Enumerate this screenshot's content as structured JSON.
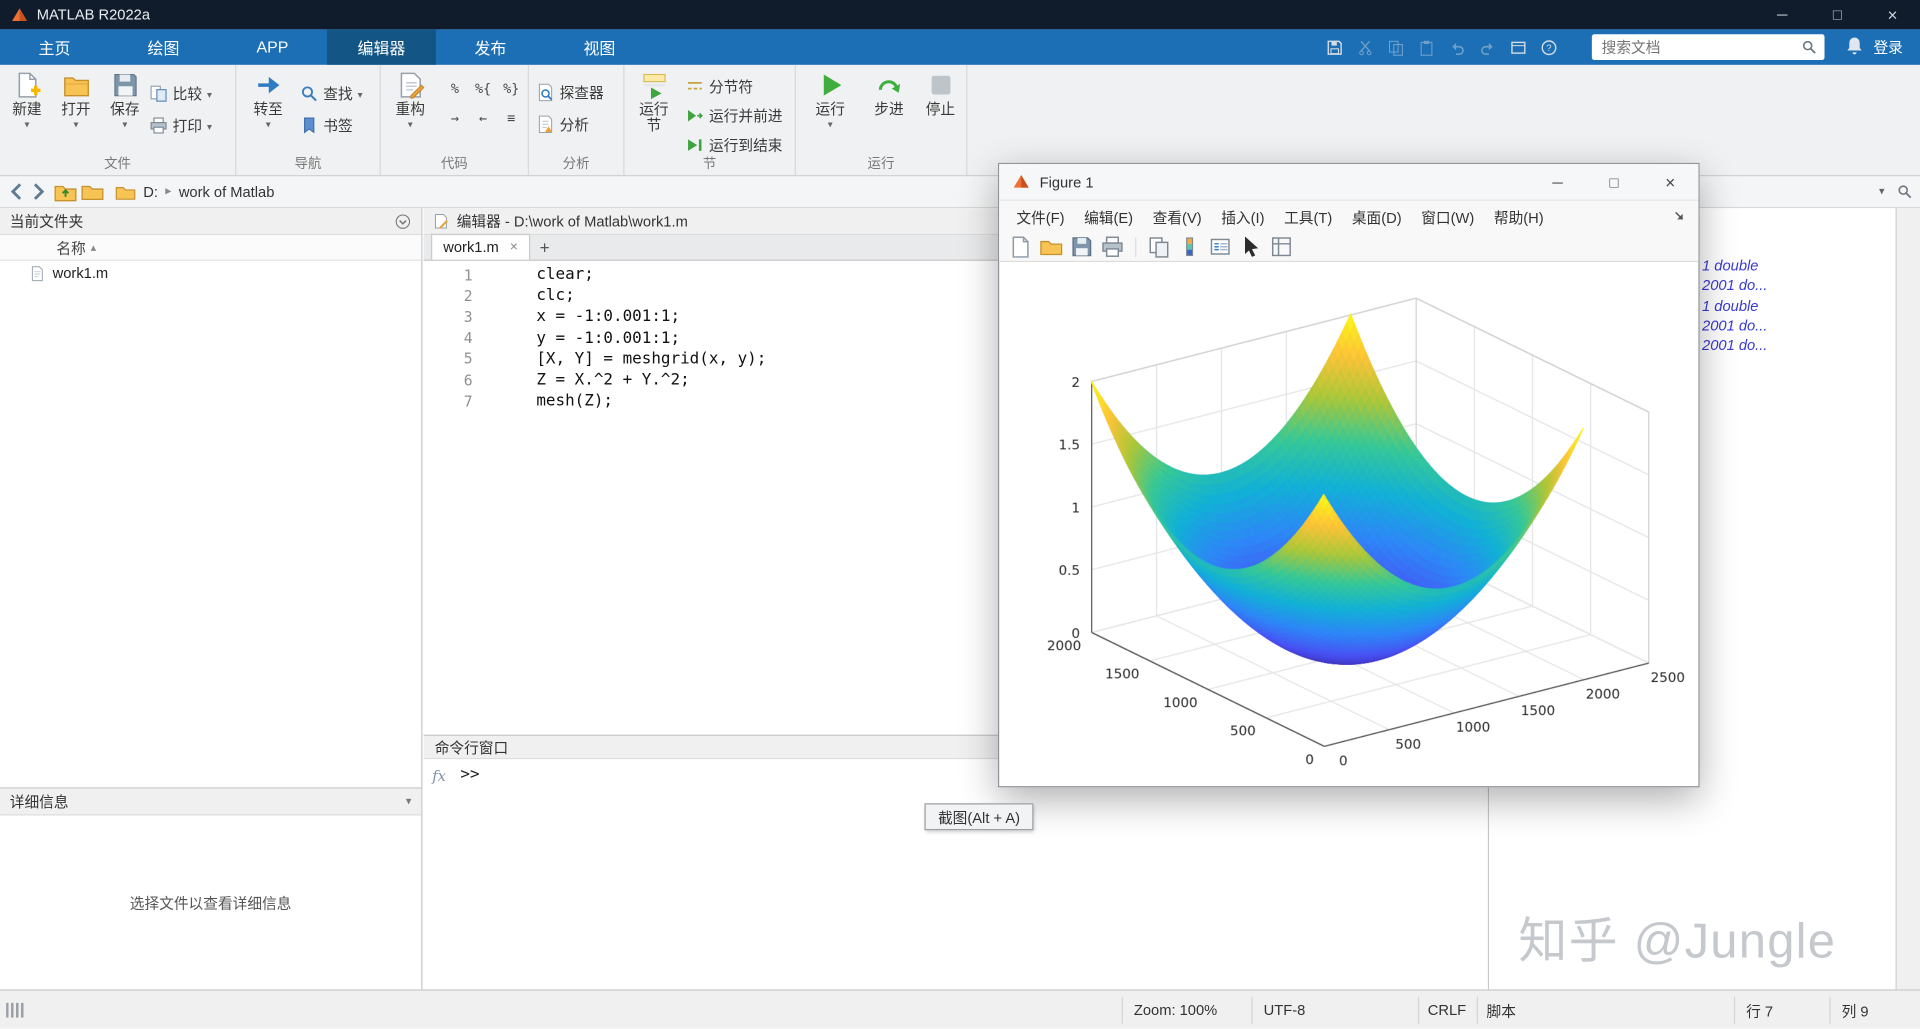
{
  "window": {
    "title": "MATLAB R2022a",
    "minimize": "─",
    "maximize": "□",
    "close": "×"
  },
  "ribbon_tabs": [
    "主页",
    "绘图",
    "APP",
    "编辑器",
    "发布",
    "视图"
  ],
  "active_tab": "编辑器",
  "quick_access": {
    "signin_label": "登录"
  },
  "doc_search": {
    "placeholder": "搜索文档"
  },
  "ribbon": {
    "file": {
      "label": "文件",
      "new": "新建",
      "open": "打开",
      "save": "保存",
      "compare": "比较",
      "print": "打印"
    },
    "navigate": {
      "label": "导航",
      "goto": "转至",
      "find": "查找",
      "bookmark": "书签"
    },
    "code": {
      "label": "代码",
      "refactor": "重构"
    },
    "analyze": {
      "label": "分析",
      "profiler": "探查器",
      "analyze_code": "分析"
    },
    "section": {
      "label": "节",
      "run_section": "运行\n节",
      "section_break": "分节符",
      "run_and_advance": "运行并前进",
      "run_to_end": "运行到结束"
    },
    "run": {
      "label": "运行",
      "run": "运行",
      "step": "步进",
      "stop": "停止"
    }
  },
  "address_bar": {
    "drive": "D:",
    "separator": "▸",
    "folder": "work of Matlab"
  },
  "current_folder": {
    "title": "当前文件夹",
    "column_name": "名称",
    "files": [
      "work1.m"
    ]
  },
  "details_panel": {
    "title": "详细信息",
    "empty_text": "选择文件以查看详细信息"
  },
  "editor": {
    "header": "编辑器 - D:\\work of Matlab\\work1.m",
    "tab": "work1.m",
    "code_lines": [
      "clear;",
      "clc;",
      "x = -1:0.001:1;",
      "y = -1:0.001:1;",
      "[X, Y] = meshgrid(x, y);",
      "Z = X.^2 + Y.^2;",
      "mesh(Z);"
    ]
  },
  "command_window": {
    "title": "命令行窗口",
    "fx": "fx",
    "prompt": ">>"
  },
  "workspace": {
    "visible_values": [
      "1 double",
      "2001 do...",
      "1 double",
      "2001 do...",
      "2001 do..."
    ]
  },
  "figure_window": {
    "title": "Figure 1",
    "menus": [
      "文件(F)",
      "编辑(E)",
      "查看(V)",
      "插入(I)",
      "工具(T)",
      "桌面(D)",
      "窗口(W)",
      "帮助(H)"
    ]
  },
  "chart_data": {
    "type": "surface",
    "function": "Z = X.^2 + Y.^2",
    "x_ticks": [
      "0",
      "500",
      "1000",
      "1500",
      "2000",
      "2500"
    ],
    "y_ticks": [
      "0",
      "500",
      "1000",
      "1500",
      "2000"
    ],
    "z_ticks": [
      "0",
      "0.5",
      "1",
      "1.5",
      "2"
    ],
    "x_range": [
      0,
      2500
    ],
    "y_range": [
      0,
      2000
    ],
    "z_range": [
      0,
      2
    ],
    "surface_extent": {
      "x": [
        0,
        2000
      ],
      "y": [
        0,
        2000
      ]
    },
    "colormap": "parula",
    "view": {
      "azimuth": -37.5,
      "elevation": 30
    },
    "grid": true
  },
  "tooltip": {
    "text": "截图(Alt + A)"
  },
  "watermark": {
    "text": "知乎 @Jungle"
  },
  "status_bar": {
    "zoom": "Zoom: 100%",
    "encoding": "UTF-8",
    "line_ending": "CRLF",
    "file_type": "脚本",
    "line": "行 7",
    "column": "列 9"
  }
}
